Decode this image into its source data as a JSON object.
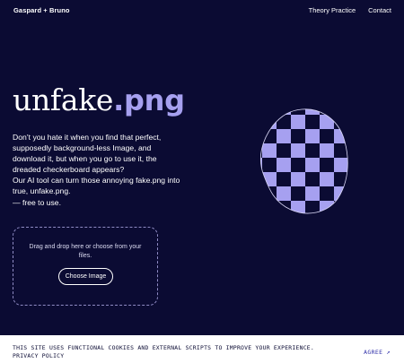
{
  "header": {
    "brand": "Gaspard + Bruno",
    "nav": [
      "Theory Practice",
      "Contact"
    ]
  },
  "hero": {
    "title_main": "unfake",
    "title_ext": ".png",
    "intro_lines": [
      "Don’t you hate it when you find that perfect, supposedly background-less Image, and download it, but when you go to use it, the dreaded checkerboard appears?",
      "Our AI tool can turn those annoying fake.png  into true, unfake.png.",
      "— free to use."
    ]
  },
  "upload": {
    "prompt": "Drag and drop here or choose from your files.",
    "button_label": "Choose Image"
  },
  "cookie": {
    "text": "THIS SITE USES FUNCTIONAL COOKIES AND EXTERNAL SCRIPTS TO IMPROVE YOUR EXPERIENCE. PRIVACY POLICY",
    "agree_label": "AGREE",
    "agree_icon": "arrow-up-right-icon"
  },
  "colors": {
    "background": "#0b0b33",
    "accent": "#a6a0f0",
    "checker_dark": "#0b0b33",
    "checker_light": "#a6a0f0",
    "cookie_bg": "#ffffff",
    "cookie_link": "#2e2ea8"
  }
}
